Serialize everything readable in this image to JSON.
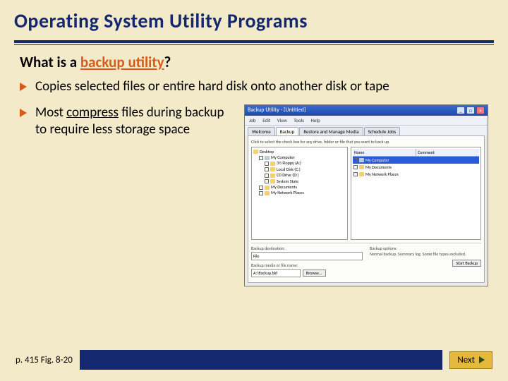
{
  "title": "Operating System Utility Programs",
  "question_prefix": "What is a ",
  "question_hl": "backup utility",
  "question_suffix": "?",
  "bullets": [
    "Copies selected files or entire hard disk onto another disk or tape",
    "Most compress files during backup to require less storage space"
  ],
  "compress_word": "compress",
  "screenshot": {
    "window_title": "Backup Utility - [Untitled]",
    "menu": [
      "Job",
      "Edit",
      "View",
      "Tools",
      "Help"
    ],
    "tabs": [
      "Welcome",
      "Backup",
      "Restore and Manage Media",
      "Schedule Jobs"
    ],
    "active_tab": "Backup",
    "instruction": "Click to select the check box for any drive, folder or file that you want to back up.",
    "tree": [
      {
        "lvl": 1,
        "label": "Desktop"
      },
      {
        "lvl": 2,
        "label": "My Computer"
      },
      {
        "lvl": 3,
        "label": "3½ Floppy (A:)"
      },
      {
        "lvl": 3,
        "label": "Local Disk (C:)"
      },
      {
        "lvl": 3,
        "label": "CD Drive (D:)"
      },
      {
        "lvl": 3,
        "label": "System State"
      },
      {
        "lvl": 2,
        "label": "My Documents"
      },
      {
        "lvl": 2,
        "label": "My Network Places"
      }
    ],
    "list_headers": [
      "Name",
      "Comment"
    ],
    "list_items": [
      "My Computer",
      "My Documents",
      "My Network Places"
    ],
    "dest_label": "Backup destination:",
    "dest_value": "File",
    "media_label": "Backup media or file name:",
    "media_value": "A:\\Backup.bkf",
    "browse": "Browse...",
    "opts_label": "Backup options:",
    "opts_text": "Normal backup. Summary log. Some file types excluded.",
    "start": "Start Backup"
  },
  "pref": "p. 415 Fig. 8-20",
  "next": "Next"
}
